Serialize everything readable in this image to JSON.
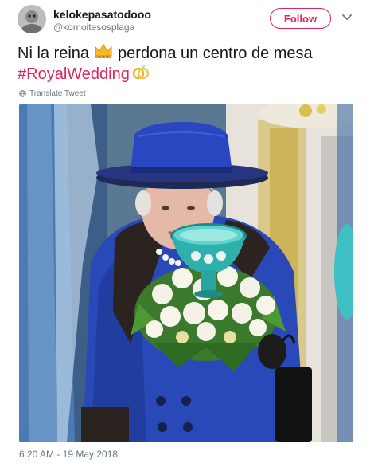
{
  "author": {
    "display_name": "kelokepasatodooo",
    "handle": "@komoitesosplaga"
  },
  "follow_label": "Follow",
  "tweet": {
    "text_line1": "Ni la reina",
    "text_line1_after": "perdona un centro de mesa",
    "hashtag": "#RoyalWedding",
    "translate_label": "Translate Tweet"
  },
  "timestamp": "6:20 AM - 19 May 2018",
  "icons": {
    "emoji_1": "crown-icon",
    "emoji_2": "rings-icon",
    "translate": "globe-icon",
    "caret": "chevron-down-icon"
  },
  "colors": {
    "accent": "#e0245e",
    "text": "#14171a",
    "secondary": "#657786",
    "coat": "#2a49b8"
  }
}
